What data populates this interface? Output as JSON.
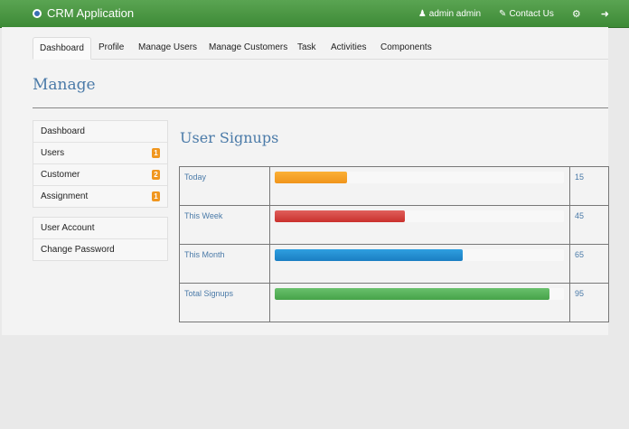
{
  "app": {
    "title": "CRM Application"
  },
  "navbar": {
    "user_label": "admin admin",
    "contact_label": "Contact Us"
  },
  "tabs": [
    {
      "label": "Dashboard",
      "active": true
    },
    {
      "label": "Profile"
    },
    {
      "label": "Manage Users"
    },
    {
      "label": "Manage Customers"
    },
    {
      "label": "Task"
    },
    {
      "label": "Activities"
    },
    {
      "label": "Components"
    }
  ],
  "page": {
    "title": "Manage"
  },
  "sidebar": {
    "group1": [
      {
        "label": "Dashboard"
      },
      {
        "label": "Users",
        "badge": "1"
      },
      {
        "label": "Customer",
        "badge": "2"
      },
      {
        "label": "Assignment",
        "badge": "1"
      }
    ],
    "group2": [
      {
        "label": "User Account"
      },
      {
        "label": "Change Password"
      }
    ]
  },
  "signups": {
    "title": "User Signups",
    "rows": [
      {
        "label": "Today",
        "value": "15",
        "fill": 0.25,
        "color": "#f0941b"
      },
      {
        "label": "This Week",
        "value": "45",
        "fill": 0.45,
        "color": "#c9302c"
      },
      {
        "label": "This Month",
        "value": "65",
        "fill": 0.65,
        "color": "#1a7ec2"
      },
      {
        "label": "Total Signups",
        "value": "95",
        "fill": 0.95,
        "color": "#46a349"
      }
    ]
  }
}
